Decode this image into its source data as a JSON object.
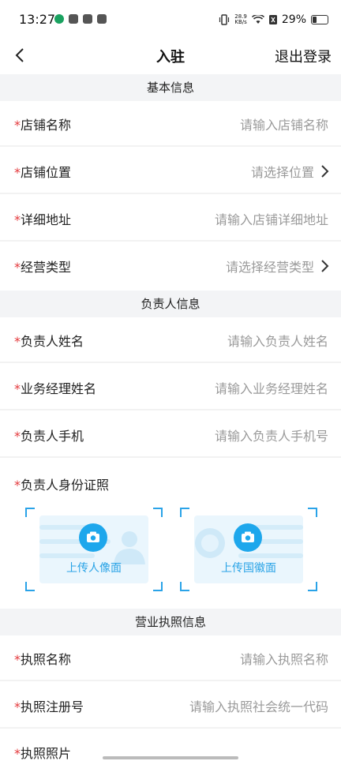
{
  "status_bar": {
    "time": "13:27",
    "speed_top": "28.9",
    "speed_unit": "KB/s",
    "battery": "29%"
  },
  "nav": {
    "title": "入驻",
    "logout_label": "退出登录"
  },
  "sections": {
    "basic": "基本信息",
    "owner": "负责人信息",
    "license": "营业执照信息"
  },
  "fields": {
    "shop_name": {
      "required": "*",
      "label": "店铺名称",
      "placeholder": "请输入店铺名称"
    },
    "shop_location": {
      "required": "*",
      "label": "店铺位置",
      "placeholder": "请选择位置"
    },
    "address": {
      "required": "*",
      "label": "详细地址",
      "placeholder": "请输入店铺详细地址"
    },
    "business_type": {
      "required": "*",
      "label": "经营类型",
      "placeholder": "请选择经营类型"
    },
    "owner_name": {
      "required": "*",
      "label": "负责人姓名",
      "placeholder": "请输入负责人姓名"
    },
    "manager_name": {
      "required": "*",
      "label": "业务经理姓名",
      "placeholder": "请输入业务经理姓名"
    },
    "owner_phone": {
      "required": "*",
      "label": "负责人手机",
      "placeholder": "请输入负责人手机号"
    },
    "id_photo": {
      "required": "*",
      "label": "负责人身份证照"
    },
    "license_name": {
      "required": "*",
      "label": "执照名称",
      "placeholder": "请输入执照名称"
    },
    "license_no": {
      "required": "*",
      "label": "执照注册号",
      "placeholder": "请输入执照社会统一代码"
    },
    "license_photo": {
      "required": "*",
      "label": "执照照片"
    }
  },
  "uploads": {
    "portrait_label": "上传人像面",
    "emblem_label": "上传国徽面"
  },
  "colors": {
    "accent": "#1ea7ec",
    "required": "#e4393c",
    "section_bg": "#f3f4f6"
  }
}
